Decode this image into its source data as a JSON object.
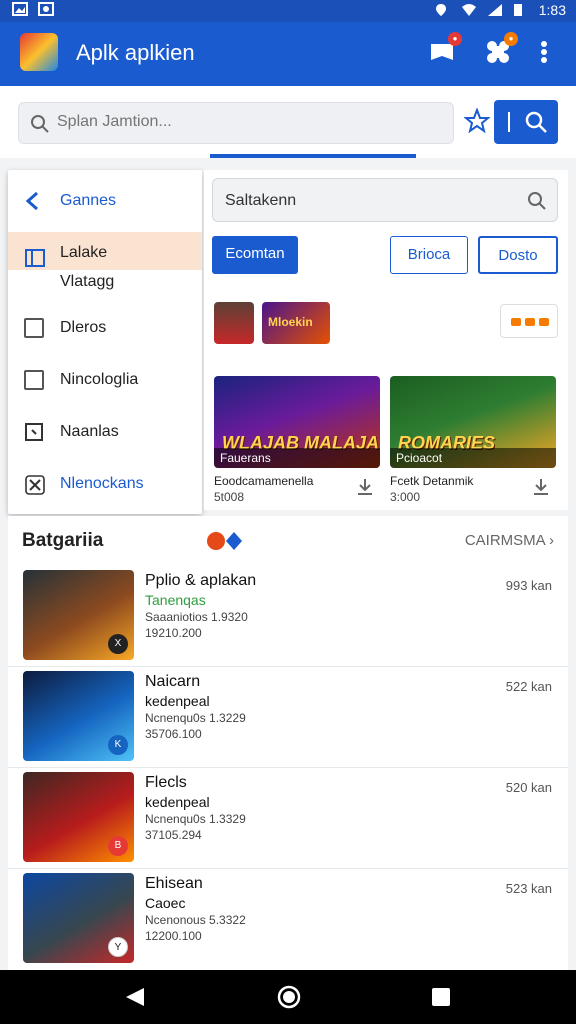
{
  "status_bar": {
    "time": "1:83"
  },
  "app": {
    "title": "Aplk aplkien"
  },
  "search": {
    "placeholder": "Splan Jamtion..."
  },
  "drawer": {
    "header": "Gannes",
    "items": [
      {
        "label": "Lalake",
        "sub": "Vlatagg",
        "active": true,
        "icon": "tablet-icon"
      },
      {
        "label": "Dleros",
        "active": false,
        "icon": "checkbox-icon"
      },
      {
        "label": "Nincologlia",
        "active": false,
        "icon": "checkbox-icon"
      },
      {
        "label": "Naanlas",
        "active": false,
        "icon": "square-icon"
      },
      {
        "label": "Nlenockans",
        "active": false,
        "icon": "tools-icon",
        "highlight": true
      }
    ]
  },
  "panel": {
    "search_text": "Saltakenn",
    "chips": [
      "Ecomtan",
      "Brioca",
      "Dosto"
    ],
    "featured": [
      {
        "title_art": "WLAJAB MALAJA",
        "caption": "Fauerans",
        "name": "Eoodcamamenella",
        "size": "5t008"
      },
      {
        "title_art": "ROMARIES",
        "caption": "Pcioacot",
        "name": "Fcetk Detanmik",
        "size": "3:000"
      }
    ],
    "mini_art_text": "Mloekin"
  },
  "category": {
    "title": "Batgariia",
    "more_label": "CAIRMSMA",
    "rows": [
      {
        "name": "Pplio & aplakan",
        "sub": "Tanenqas",
        "sub_color": "#2e9e3e",
        "line3": "Saaaniotios 1.9320",
        "line4": "19210.200",
        "size": "993 kan",
        "badge": "X"
      },
      {
        "name": "Naicarn",
        "sub": "kedenpeal",
        "sub_color": "#111111",
        "line3": "Ncnenqu0s 1.3229",
        "line4": "35706.100",
        "size": "522 kan",
        "badge": "K"
      },
      {
        "name": "Flecls",
        "sub": "kedenpeal",
        "sub_color": "#111111",
        "line3": "Ncnenqu0s 1.3329",
        "line4": "37105.294",
        "size": "520 kan",
        "badge": "B"
      },
      {
        "name": "Ehisean",
        "sub": "Caoec",
        "sub_color": "#333333",
        "line3": "Ncenonous 5.3322",
        "line4": "12200.100",
        "size": "523 kan",
        "badge": "Y"
      }
    ]
  },
  "colors": {
    "primary": "#1a5bd0",
    "active_drawer": "#fbe3d2",
    "accent_orange": "#f57c00"
  }
}
